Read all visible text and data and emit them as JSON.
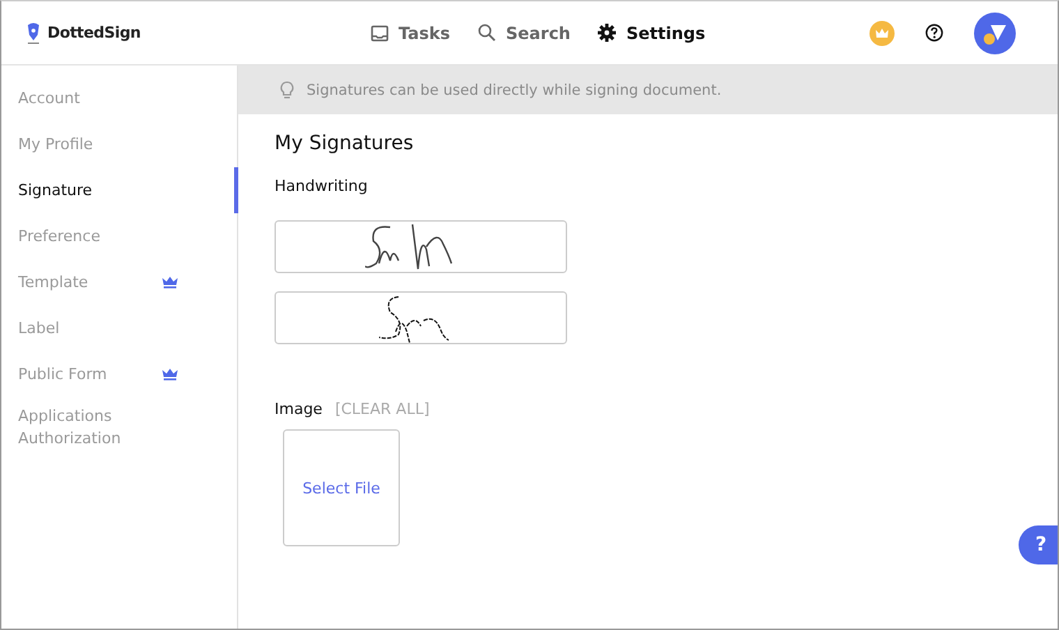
{
  "header": {
    "logo": "DottedSign",
    "nav": [
      {
        "kind": "tasks",
        "label": "Tasks",
        "selected": false
      },
      {
        "kind": "search",
        "label": "Search",
        "selected": false
      },
      {
        "kind": "settings",
        "label": "Settings",
        "selected": true
      }
    ]
  },
  "sidebar": {
    "items": [
      {
        "label": "Account",
        "selected": false,
        "premium": false
      },
      {
        "label": "My Profile",
        "selected": false,
        "premium": false
      },
      {
        "label": "Signature",
        "selected": true,
        "premium": false
      },
      {
        "label": "Preference",
        "selected": false,
        "premium": false
      },
      {
        "label": "Template",
        "selected": false,
        "premium": true
      },
      {
        "label": "Label",
        "selected": false,
        "premium": false
      },
      {
        "label": "Public Form",
        "selected": false,
        "premium": true
      },
      {
        "label": "Applications Authorization",
        "selected": false,
        "premium": false
      }
    ]
  },
  "notice": "Signatures can be used directly while signing document.",
  "title": "My Signatures",
  "handwriting": {
    "label": "Handwriting",
    "signatures": [
      {
        "kind": "long"
      },
      {
        "kind": "short"
      }
    ]
  },
  "image": {
    "label": "Image",
    "clear": "[CLEAR ALL]",
    "select": "Select File"
  },
  "help_button": "?"
}
